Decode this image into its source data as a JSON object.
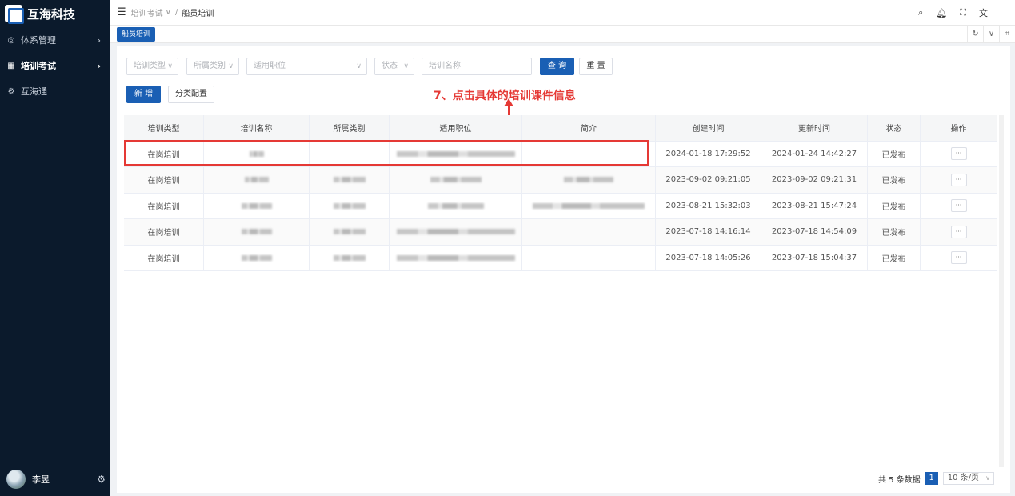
{
  "app": {
    "logo_text": "互海科技"
  },
  "sidebar": {
    "items": [
      {
        "icon": "sms-icon",
        "icon_glyph": "◎",
        "label": "体系管理",
        "active": false
      },
      {
        "icon": "grid-icon",
        "icon_glyph": "▦",
        "label": "培训考试",
        "active": true
      },
      {
        "icon": "gear-icon",
        "icon_glyph": "⚙",
        "label": "互海通",
        "active": false
      }
    ],
    "user": {
      "name": "李昱"
    }
  },
  "header": {
    "breadcrumb": [
      "培训考试",
      "船员培训"
    ],
    "icons": [
      "search-icon",
      "bell-icon",
      "fullscreen-icon",
      "translate-icon"
    ]
  },
  "tabs": [
    {
      "label": "船员培训",
      "active": true
    }
  ],
  "filters": {
    "training_type_placeholder": "培训类型",
    "category_placeholder": "所属类别",
    "position_placeholder": "适用职位",
    "status_placeholder": "状态",
    "name_placeholder": "培训名称",
    "search_label": "查 询",
    "reset_label": "重 置"
  },
  "actions": {
    "add_label": "新 增",
    "category_config_label": "分类配置"
  },
  "annotation": {
    "text": "7、点击具体的培训课件信息"
  },
  "table": {
    "columns": [
      "培训类型",
      "培训名称",
      "所属类别",
      "适用职位",
      "简介",
      "创建时间",
      "更新时间",
      "状态",
      "操作"
    ],
    "rows": [
      {
        "type": "在岗培训",
        "created": "2024-01-18 17:29:52",
        "updated": "2024-01-24 14:42:27",
        "status": "已发布",
        "op": "···"
      },
      {
        "type": "在岗培训",
        "created": "2023-09-02 09:21:05",
        "updated": "2023-09-02 09:21:31",
        "status": "已发布",
        "op": "···"
      },
      {
        "type": "在岗培训",
        "created": "2023-08-21 15:32:03",
        "updated": "2023-08-21 15:47:24",
        "status": "已发布",
        "op": "···"
      },
      {
        "type": "在岗培训",
        "created": "2023-07-18 14:16:14",
        "updated": "2023-07-18 14:54:09",
        "status": "已发布",
        "op": "···"
      },
      {
        "type": "在岗培训",
        "created": "2023-07-18 14:05:26",
        "updated": "2023-07-18 15:04:37",
        "status": "已发布",
        "op": "···"
      }
    ]
  },
  "pagination": {
    "total_text": "共 5 条数据",
    "current_page": "1",
    "page_size": "10 条/页"
  },
  "colors": {
    "primary": "#1a5fb4",
    "sidebar_bg": "#0b1a2c",
    "annotation": "#e53935"
  }
}
